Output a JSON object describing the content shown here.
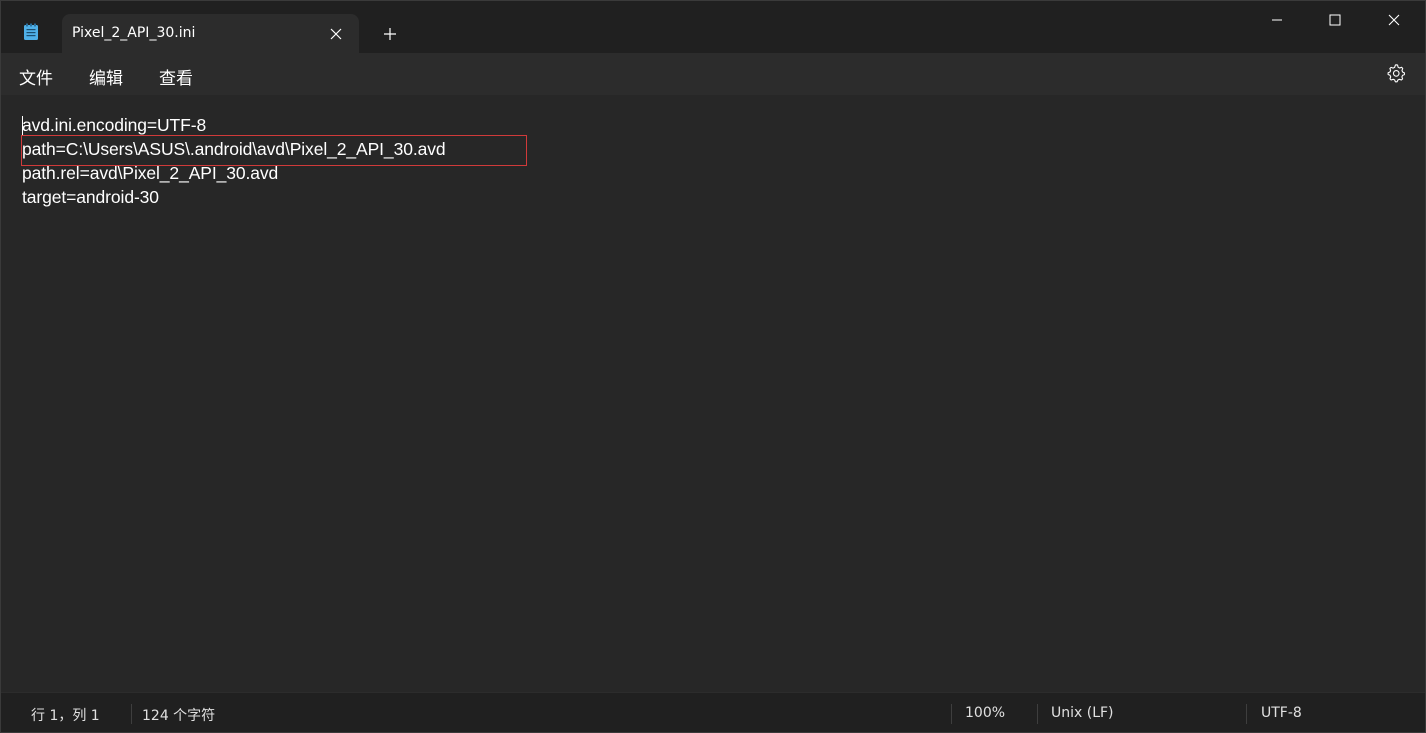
{
  "tab": {
    "title": "Pixel_2_API_30.ini"
  },
  "menu": {
    "file": "文件",
    "edit": "编辑",
    "view": "查看"
  },
  "editor": {
    "lines": [
      "avd.ini.encoding=UTF-8",
      "path=C:\\Users\\ASUS\\.android\\avd\\Pixel_2_API_30.avd",
      "path.rel=avd\\Pixel_2_API_30.avd",
      "target=android-30"
    ]
  },
  "status": {
    "position": "行 1，列 1",
    "char_count": "124 个字符",
    "zoom": "100%",
    "line_ending": "Unix (LF)",
    "encoding": "UTF-8"
  },
  "icons": {
    "app": "notepad-icon",
    "tab_close": "close-icon",
    "new_tab": "plus-icon",
    "minimize": "minimize-icon",
    "maximize": "maximize-icon",
    "close": "close-icon",
    "settings": "gear-icon"
  },
  "colors": {
    "background": "#202020",
    "editor": "#272727",
    "menubar": "#2c2c2c",
    "highlight": "#d03a3a",
    "app_icon": "#4fb0e8"
  }
}
